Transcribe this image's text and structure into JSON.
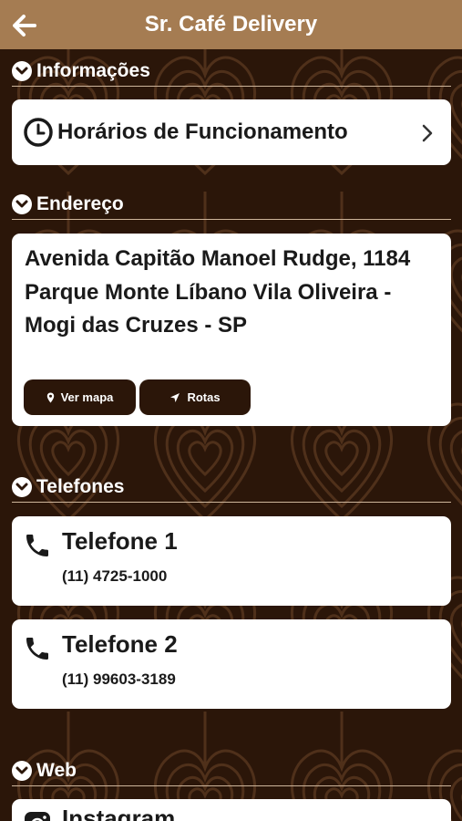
{
  "appbar": {
    "title": "Sr. Café Delivery",
    "back_icon": "arrow-left-icon"
  },
  "sections": {
    "info": {
      "label": "Informações",
      "hours_label": "Horários de Funcionamento"
    },
    "address": {
      "label": "Endereço",
      "text": "Avenida Capitão Manoel Rudge, 1184 Parque Monte Líbano Vila Oliveira - Mogi das Cruzes - SP",
      "map_button": "Ver mapa",
      "route_button": "Rotas"
    },
    "phones": {
      "label": "Telefones",
      "items": [
        {
          "title": "Telefone 1",
          "number": "(11) 4725-1000"
        },
        {
          "title": "Telefone 2",
          "number": "(11) 99603-3189"
        }
      ]
    },
    "web": {
      "label": "Web",
      "first_item": "Instagram"
    }
  },
  "colors": {
    "appbar": "#a57c52",
    "background": "#2b1609",
    "card": "#ffffff",
    "button": "#2b1609"
  }
}
